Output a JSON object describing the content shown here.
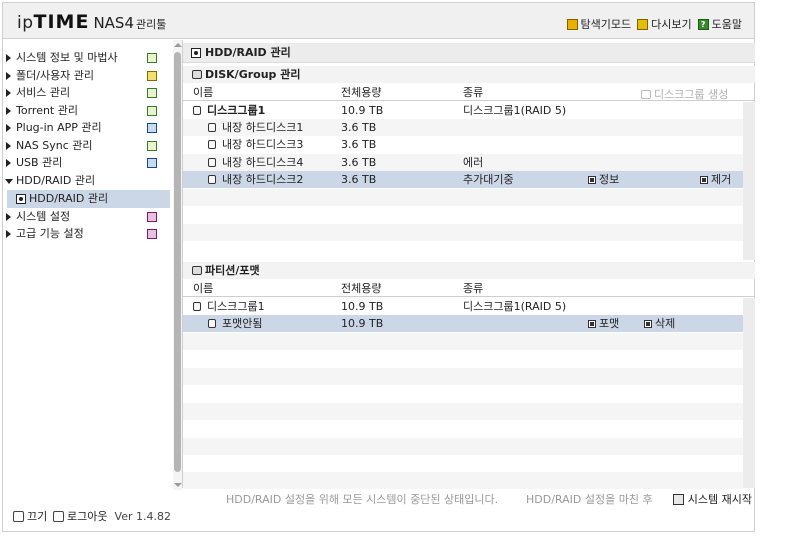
{
  "header": {
    "logo_ip": "ip",
    "logo_time": "TIME",
    "logo_nas": "NAS4",
    "logo_mgr": "관리툴",
    "links": [
      {
        "label": "탐색기모드",
        "icon": "explorer-icon"
      },
      {
        "label": "다시보기",
        "icon": "refresh-icon"
      },
      {
        "label": "도움말",
        "icon": "help-icon"
      }
    ]
  },
  "sidebar": {
    "items": [
      {
        "label": "시스템 정보 및 마법사",
        "icon": "chart-icon"
      },
      {
        "label": "폴더/사용자 관리",
        "icon": "folder-user-icon"
      },
      {
        "label": "서비스 관리",
        "icon": "service-icon"
      },
      {
        "label": "Torrent 관리",
        "icon": "torrent-icon"
      },
      {
        "label": "Plug-in APP 관리",
        "icon": "plugin-icon"
      },
      {
        "label": "NAS Sync 관리",
        "icon": "sync-icon"
      },
      {
        "label": "USB 관리",
        "icon": "usb-icon"
      },
      {
        "label": "HDD/RAID 관리",
        "icon": ""
      },
      {
        "label": "시스템 설정",
        "icon": "settings-icon"
      },
      {
        "label": "고급 기능 설정",
        "icon": "advanced-icon"
      }
    ],
    "sub_selected": "HDD/RAID 관리",
    "logout": "로그아웃",
    "power": "끄기",
    "version": "Ver 1.4.82"
  },
  "main": {
    "title": "HDD/RAID 관리",
    "disk_group": {
      "heading": "DISK/Group 관리",
      "create_action": "디스크그룹 생성",
      "columns": [
        "이름",
        "전체용량",
        "종류"
      ],
      "rows": [
        {
          "name": "디스크그룹1",
          "capacity": "10.9 TB",
          "type": "디스크그룹1(RAID 5)",
          "bold": true
        },
        {
          "name": "내장 하드디스크1",
          "capacity": "3.6 TB",
          "type": ""
        },
        {
          "name": "내장 하드디스크3",
          "capacity": "3.6 TB",
          "type": ""
        },
        {
          "name": "내장 하드디스크4",
          "capacity": "3.6 TB",
          "type": "에러"
        },
        {
          "name": "내장 하드디스크2",
          "capacity": "3.6 TB",
          "type": "추가대기중",
          "action1": "정보",
          "action2": "제거"
        }
      ]
    },
    "partition": {
      "heading": "파티션/포맷",
      "columns": [
        "이름",
        "전체용량",
        "종류"
      ],
      "rows": [
        {
          "name": "디스크그룹1",
          "capacity": "10.9 TB",
          "type": "디스크그룹1(RAID 5)"
        },
        {
          "name": "포맷안됨",
          "capacity": "10.9 TB",
          "type": "",
          "action1": "포맷",
          "action2": "삭제"
        }
      ]
    }
  },
  "status": {
    "message_left": "HDD/RAID 설정을 위해 모든 시스템이 중단된 상태입니다.",
    "message_right": "HDD/RAID 설정을 마친 후",
    "restart": "시스템 재시작"
  }
}
